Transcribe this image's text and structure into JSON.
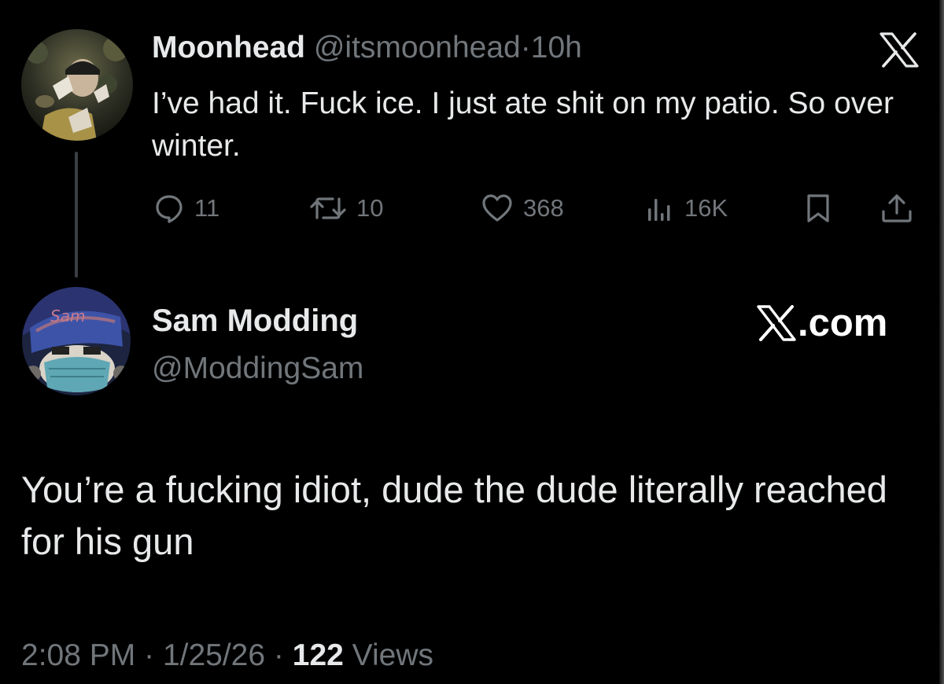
{
  "original_tweet": {
    "display_name": "Moonhead",
    "handle": "@itsmoonhead",
    "separator": "·",
    "time_ago": "10h",
    "text": "I’ve had it. Fuck ice. I just ate shit on my patio. So over winter.",
    "logo_icon": "x-logo-icon",
    "stats": {
      "replies": "11",
      "reposts": "10",
      "likes": "368",
      "views": "16K"
    }
  },
  "reply_tweet": {
    "display_name": "Sam Modding",
    "handle": "@ModdingSam",
    "site_label": ".com",
    "text": "You’re a fucking idiot, dude the dude literally reached for his gun",
    "timestamp": "2:08 PM",
    "date": "1/25/26",
    "separator": "·",
    "views_count": "122",
    "views_label": "Views"
  },
  "colors": {
    "background": "#000000",
    "text_primary": "#e7e9ea",
    "text_muted": "#71767b",
    "thread_line": "#3b3f43"
  }
}
